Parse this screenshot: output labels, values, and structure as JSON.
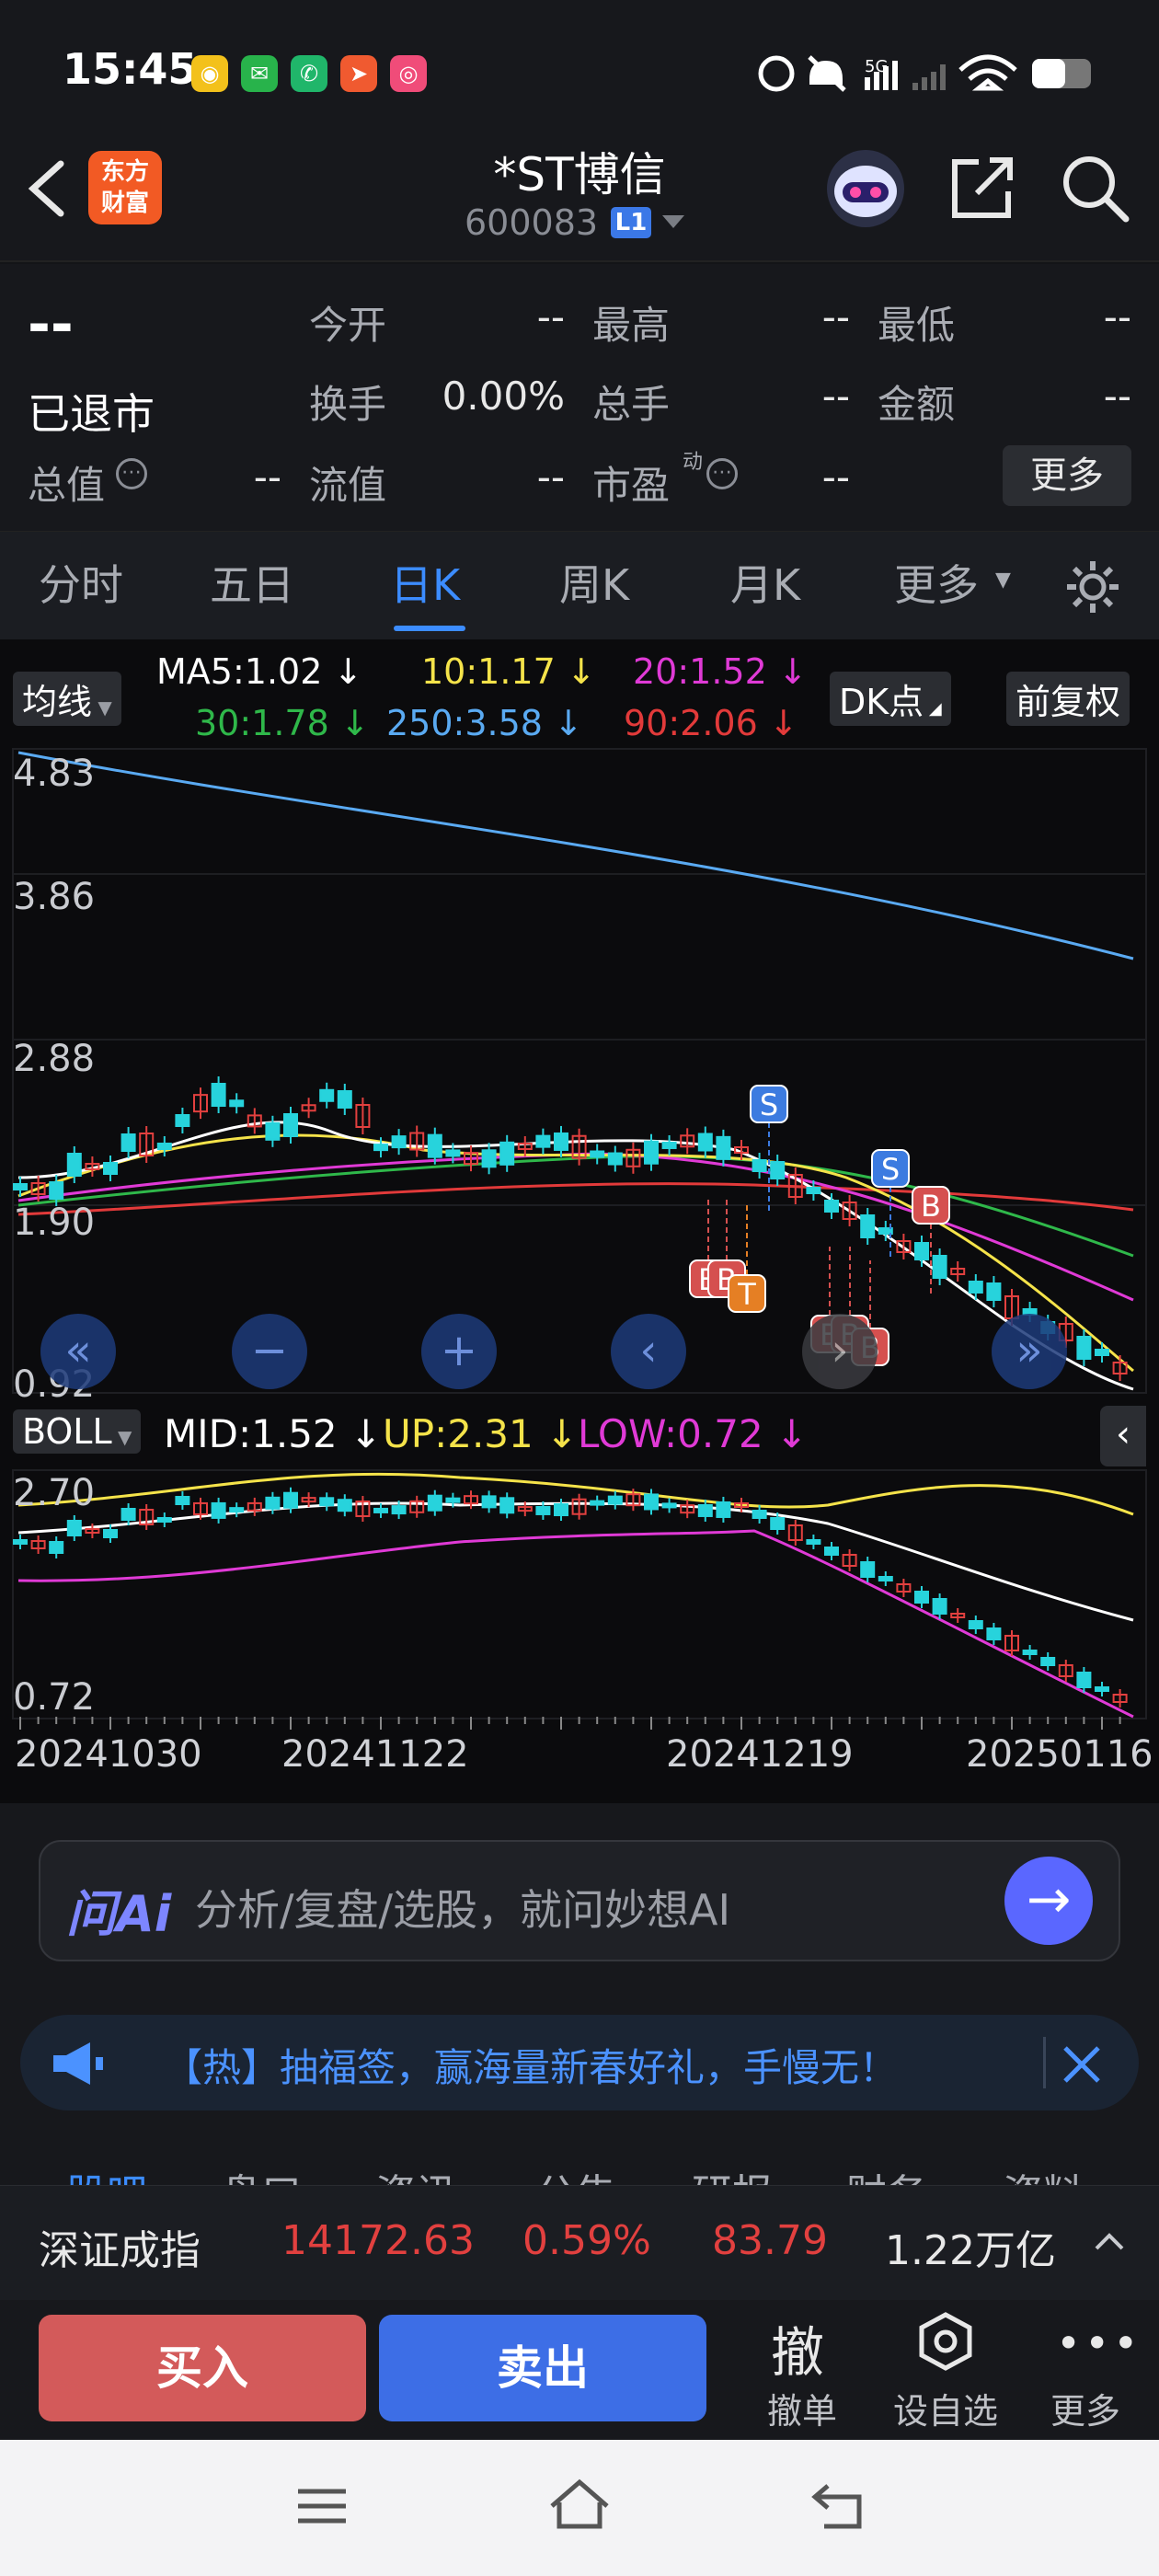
{
  "status": {
    "time": "15:45"
  },
  "header": {
    "logo_text": "东方\n财富",
    "title": "*ST博信",
    "code": "600083",
    "level_badge": "L1"
  },
  "quote": {
    "price": "--",
    "state": "已退市",
    "fields": [
      {
        "label": "今开",
        "value": "--"
      },
      {
        "label": "最高",
        "value": "--"
      },
      {
        "label": "最低",
        "value": "--"
      },
      {
        "label": "换手",
        "value": "0.00%"
      },
      {
        "label": "总手",
        "value": "--"
      },
      {
        "label": "金额",
        "value": "--"
      },
      {
        "label": "总值",
        "value": "--"
      },
      {
        "label": "流值",
        "value": "--"
      },
      {
        "label": "市盈",
        "value": "--"
      }
    ],
    "dynamic_mark": "动",
    "more_button": "更多"
  },
  "tabs": [
    "分时",
    "五日",
    "日K",
    "周K",
    "月K",
    "更多"
  ],
  "active_tab": "日K",
  "ma_panel": {
    "selector": "均线",
    "labels": [
      {
        "text": "MA5:1.02 ↓",
        "color": "#ffffff"
      },
      {
        "text": "10:1.17 ↓",
        "color": "#f5e34a"
      },
      {
        "text": "20:1.52 ↓",
        "color": "#e03ad6"
      },
      {
        "text": "30:1.78 ↓",
        "color": "#2fb84a"
      },
      {
        "text": "250:3.58 ↓",
        "color": "#5aaaf2"
      },
      {
        "text": "90:2.06 ↓",
        "color": "#e23a3a"
      }
    ],
    "dk_button": "DK点",
    "adj_button": "前复权",
    "y_labels": [
      "4.83",
      "3.86",
      "2.88",
      "1.90",
      "0.92"
    ]
  },
  "boll_panel": {
    "selector": "BOLL",
    "labels": [
      {
        "text": "MID:1.52 ↓",
        "color": "#ffffff"
      },
      {
        "text": "UP:2.31 ↓",
        "color": "#f5e34a"
      },
      {
        "text": "LOW:0.72 ↓",
        "color": "#e03ad6"
      }
    ],
    "y_labels": [
      "2.70",
      "0.72"
    ]
  },
  "x_labels": [
    "20241030",
    "20241122",
    "20241219",
    "20250116"
  ],
  "signal_markers": {
    "sell": "S",
    "buy": "B",
    "t": "T"
  },
  "ai": {
    "logo": "问Ai",
    "placeholder": "分析/复盘/选股，就问妙想AI"
  },
  "notice": {
    "text": "【热】抽福签，赢海量新春好礼，手慢无！"
  },
  "sub_tabs": [
    "股吧",
    "盘口",
    "资讯",
    "公告",
    "研报",
    "财务",
    "资料"
  ],
  "index_bar": {
    "name": "深证成指",
    "price": "14172.63",
    "pct": "0.59%",
    "chg": "83.79",
    "amount": "1.22万亿"
  },
  "actions": {
    "buy": "买入",
    "sell": "卖出",
    "cancel_glyph": "撤",
    "cancel": "撤单",
    "watch": "设自选",
    "more": "更多"
  },
  "colors": {
    "up": "#e2403f",
    "down": "#27d3dc",
    "accent": "#3c8cff"
  }
}
